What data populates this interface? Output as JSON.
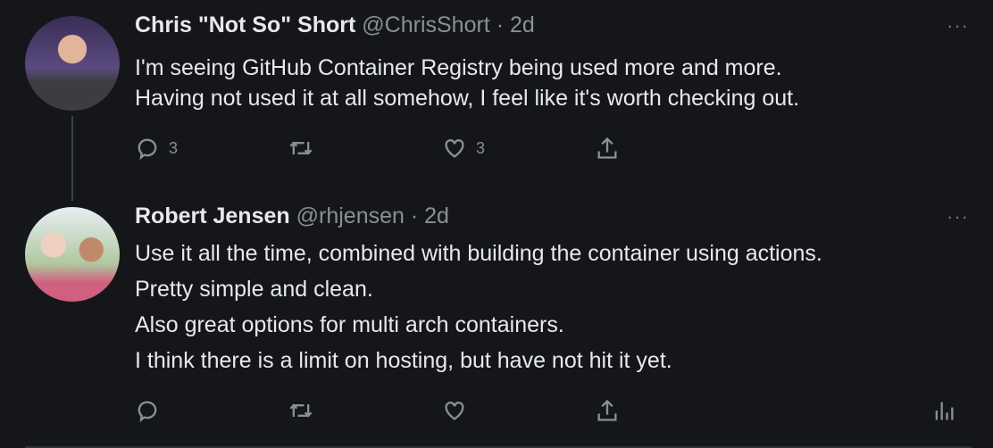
{
  "tweets": [
    {
      "name": "Chris \"Not So\" Short",
      "handle": "@ChrisShort",
      "time": "· 2d",
      "lines": [
        "I'm seeing GitHub Container Registry being used more and more.",
        "Having not used it at all somehow, I feel like it's worth checking out."
      ],
      "replies": "3",
      "retweets": "",
      "likes": "3"
    },
    {
      "name": "Robert Jensen",
      "handle": "@rhjensen",
      "time": "· 2d",
      "lines": [
        "Use it all the time, combined with building the container using actions.",
        "Pretty simple and clean.",
        "Also great options for multi arch containers.",
        "I think there is a limit on hosting, but have not hit it yet."
      ],
      "replies": "",
      "retweets": "",
      "likes": ""
    }
  ],
  "more_label": "···",
  "colors": {
    "background": "#15161a",
    "text": "#e7e9ea",
    "muted": "#8b8f94"
  }
}
